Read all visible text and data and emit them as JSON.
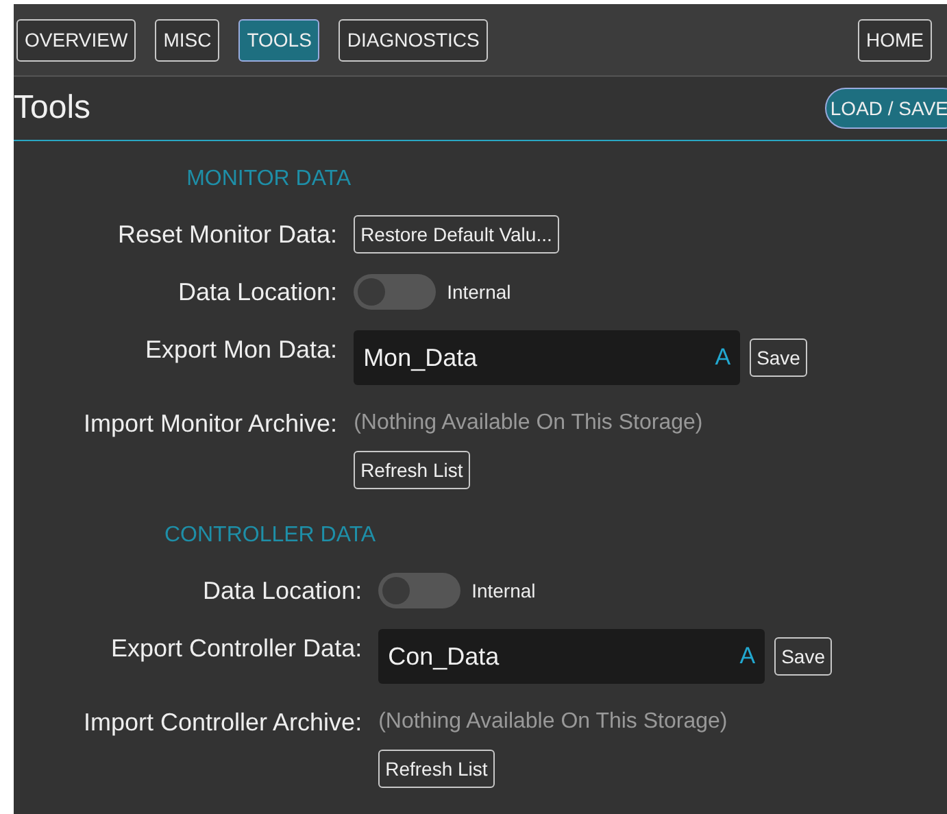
{
  "nav": {
    "tabs": [
      {
        "label": "OVERVIEW",
        "selected": false
      },
      {
        "label": "MISC",
        "selected": false
      },
      {
        "label": "TOOLS",
        "selected": true
      },
      {
        "label": "DIAGNOSTICS",
        "selected": false
      }
    ],
    "home": "HOME"
  },
  "header": {
    "title": "Tools",
    "button": "LOAD / SAVE"
  },
  "sections": [
    {
      "title": "MONITOR DATA",
      "rows": [
        {
          "kind": "button",
          "label": "Reset Monitor Data:",
          "button": "Restore Default Valu..."
        },
        {
          "kind": "toggle",
          "label": "Data Location:",
          "on": false,
          "text": "Internal"
        },
        {
          "kind": "field",
          "label": "Export Mon Data:",
          "value": "Mon_Data",
          "icon": "A",
          "button": "Save"
        },
        {
          "kind": "import",
          "label": "Import Monitor Archive:",
          "note": "(Nothing Available On This Storage)",
          "button": "Refresh List"
        }
      ]
    },
    {
      "title": "CONTROLLER DATA",
      "rows": [
        {
          "kind": "toggle",
          "label": "Data Location:",
          "on": false,
          "text": "Internal"
        },
        {
          "kind": "field",
          "label": "Export Controller Data:",
          "value": "Con_Data",
          "icon": "A",
          "button": "Save"
        },
        {
          "kind": "import",
          "label": "Import Controller Archive:",
          "note": "(Nothing Available On This Storage)",
          "button": "Refresh List"
        }
      ]
    }
  ]
}
